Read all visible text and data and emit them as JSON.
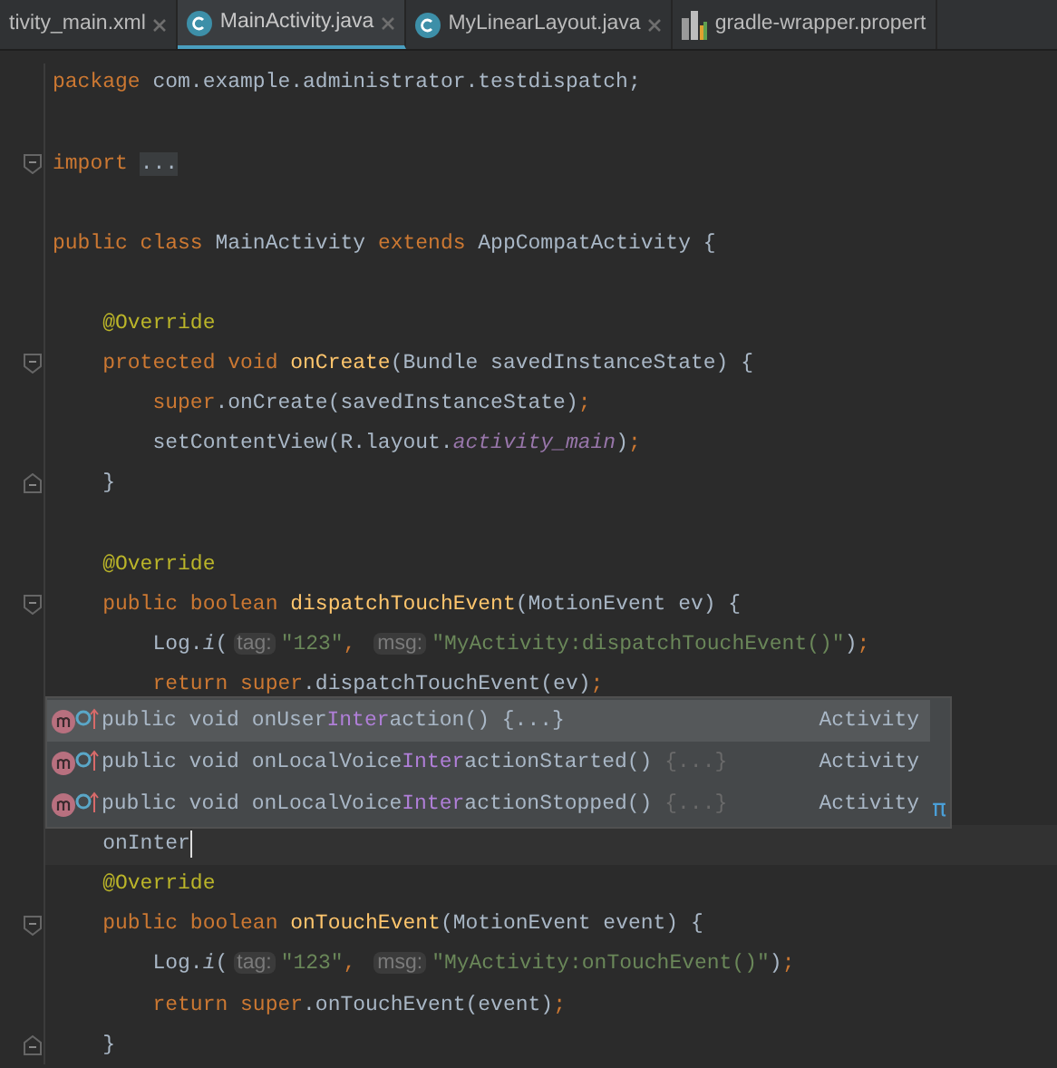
{
  "tabs": [
    {
      "label": "tivity_main.xml",
      "kind": "plain",
      "selected": false,
      "closable": true
    },
    {
      "label": "MainActivity.java",
      "kind": "class",
      "selected": true,
      "closable": true
    },
    {
      "label": "MyLinearLayout.java",
      "kind": "class",
      "selected": false,
      "closable": true
    },
    {
      "label": "gradle-wrapper.propert",
      "kind": "properties",
      "selected": false,
      "closable": false
    }
  ],
  "code_lines": [
    {
      "kind": "code",
      "tokens": [
        {
          "kind": "kw",
          "text": "package "
        },
        {
          "kind": "plain",
          "text": "com.example.administrator.testdispatch;"
        }
      ]
    },
    {
      "kind": "code"
    },
    {
      "kind": "fold_start",
      "tokens": [
        {
          "kind": "kw",
          "text": "import "
        },
        {
          "kind": "folded",
          "text": "..."
        }
      ]
    },
    {
      "kind": "code"
    },
    {
      "kind": "code",
      "tokens": [
        {
          "kind": "kw",
          "text": "public class "
        },
        {
          "kind": "plain",
          "text": "MainActivity "
        },
        {
          "kind": "kw",
          "text": "extends "
        },
        {
          "kind": "plain",
          "text": "AppCompatActivity {"
        }
      ]
    },
    {
      "kind": "code"
    },
    {
      "kind": "code",
      "tokens": [
        {
          "kind": "ann",
          "text": "    @Override"
        }
      ]
    },
    {
      "kind": "fold_start",
      "tokens": [
        {
          "kind": "kw",
          "text": "    protected void "
        },
        {
          "kind": "fn",
          "text": "onCreate"
        },
        {
          "kind": "plain",
          "text": "(Bundle savedInstanceState) {"
        }
      ]
    },
    {
      "kind": "code",
      "tokens": [
        {
          "kind": "kw",
          "text": "        super"
        },
        {
          "kind": "plain",
          "text": ".onCreate(savedInstanceState)"
        },
        {
          "kind": "kw",
          "text": ";"
        }
      ]
    },
    {
      "kind": "code",
      "tokens": [
        {
          "kind": "plain",
          "text": "        setContentView(R.layout."
        },
        {
          "kind": "field",
          "text": "activity_main"
        },
        {
          "kind": "plain",
          "text": ")"
        },
        {
          "kind": "kw",
          "text": ";"
        }
      ]
    },
    {
      "kind": "fold_end",
      "tokens": [
        {
          "kind": "plain",
          "text": "    }"
        }
      ]
    },
    {
      "kind": "code"
    },
    {
      "kind": "code",
      "tokens": [
        {
          "kind": "ann",
          "text": "    @Override"
        }
      ]
    },
    {
      "kind": "fold_start",
      "tokens": [
        {
          "kind": "kw",
          "text": "    public boolean "
        },
        {
          "kind": "fn",
          "text": "dispatchTouchEvent"
        },
        {
          "kind": "plain",
          "text": "(MotionEvent ev) {"
        }
      ]
    },
    {
      "kind": "code",
      "tokens": [
        {
          "kind": "plain",
          "text": "        Log."
        },
        {
          "kind": "italic",
          "text": "i"
        },
        {
          "kind": "plain",
          "text": "("
        },
        {
          "kind": "hint",
          "text": "tag:"
        },
        {
          "kind": "str",
          "text": "\"123\""
        },
        {
          "kind": "kw",
          "text": ", "
        },
        {
          "kind": "hint",
          "text": "msg:"
        },
        {
          "kind": "str",
          "text": "\"MyActivity:dispatchTouchEvent()\""
        },
        {
          "kind": "plain",
          "text": ")"
        },
        {
          "kind": "kw",
          "text": ";"
        }
      ]
    },
    {
      "kind": "code",
      "tokens": [
        {
          "kind": "kw",
          "text": "        return super"
        },
        {
          "kind": "plain",
          "text": ".dispatchTouchEvent(ev)"
        },
        {
          "kind": "kw",
          "text": ";"
        }
      ]
    },
    {
      "kind": "code"
    },
    {
      "kind": "code"
    },
    {
      "kind": "code"
    },
    {
      "kind": "code",
      "current": true,
      "tokens": [
        {
          "kind": "plain",
          "text": "    onInter"
        }
      ]
    },
    {
      "kind": "code",
      "tokens": [
        {
          "kind": "ann",
          "text": "    @Override"
        }
      ]
    },
    {
      "kind": "fold_start",
      "tokens": [
        {
          "kind": "kw",
          "text": "    public boolean "
        },
        {
          "kind": "fn",
          "text": "onTouchEvent"
        },
        {
          "kind": "plain",
          "text": "(MotionEvent event) {"
        }
      ]
    },
    {
      "kind": "code",
      "tokens": [
        {
          "kind": "plain",
          "text": "        Log."
        },
        {
          "kind": "italic",
          "text": "i"
        },
        {
          "kind": "plain",
          "text": "("
        },
        {
          "kind": "hint",
          "text": "tag:"
        },
        {
          "kind": "str",
          "text": "\"123\""
        },
        {
          "kind": "kw",
          "text": ", "
        },
        {
          "kind": "hint",
          "text": "msg:"
        },
        {
          "kind": "str",
          "text": "\"MyActivity:onTouchEvent()\""
        },
        {
          "kind": "plain",
          "text": ")"
        },
        {
          "kind": "kw",
          "text": ";"
        }
      ]
    },
    {
      "kind": "code",
      "tokens": [
        {
          "kind": "kw",
          "text": "        return super"
        },
        {
          "kind": "plain",
          "text": ".onTouchEvent(event)"
        },
        {
          "kind": "kw",
          "text": ";"
        }
      ]
    },
    {
      "kind": "fold_end",
      "tokens": [
        {
          "kind": "plain",
          "text": "    }"
        }
      ]
    }
  ],
  "completion_popup": {
    "items": [
      {
        "selected": true,
        "parts": [
          {
            "kind": "plain",
            "text": "public void "
          },
          {
            "kind": "name",
            "text": "onUser"
          },
          {
            "kind": "match",
            "text": "Inter"
          },
          {
            "kind": "name",
            "text": "action"
          },
          {
            "kind": "plain",
            "text": "() {...}"
          }
        ],
        "type": "Activity"
      },
      {
        "selected": false,
        "parts": [
          {
            "kind": "plain",
            "text": "public void "
          },
          {
            "kind": "name",
            "text": "onLocalVoice"
          },
          {
            "kind": "match",
            "text": "Inter"
          },
          {
            "kind": "name",
            "text": "actionStarted"
          },
          {
            "kind": "plain",
            "text": "() "
          },
          {
            "kind": "dim",
            "text": "{...}"
          }
        ],
        "type": "Activity"
      },
      {
        "selected": false,
        "parts": [
          {
            "kind": "plain",
            "text": "public void "
          },
          {
            "kind": "name",
            "text": "onLocalVoice"
          },
          {
            "kind": "match",
            "text": "Inter"
          },
          {
            "kind": "name",
            "text": "actionStopped"
          },
          {
            "kind": "plain",
            "text": "() "
          },
          {
            "kind": "dim",
            "text": "{...}"
          }
        ],
        "type": "Activity"
      }
    ],
    "footer_symbol": "π"
  }
}
